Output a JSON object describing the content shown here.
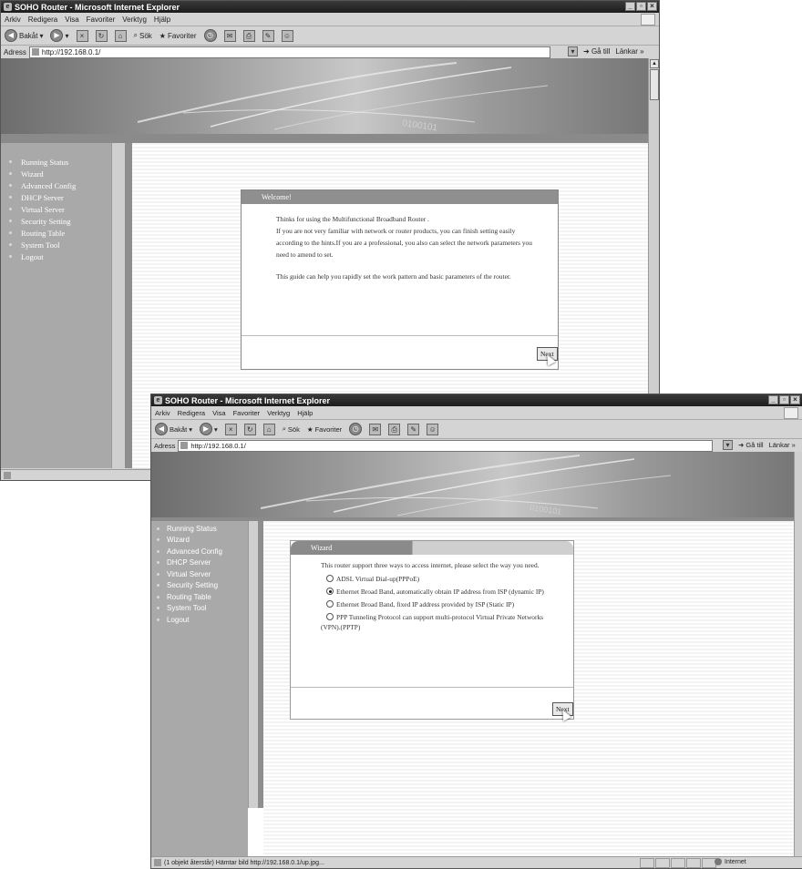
{
  "window1": {
    "title": "SOHO Router - Microsoft Internet Explorer",
    "menu": [
      "Arkiv",
      "Redigera",
      "Visa",
      "Favoriter",
      "Verktyg",
      "Hjälp"
    ],
    "toolbar": {
      "back": "Bakåt",
      "search": "Sök",
      "favorites": "Favoriter"
    },
    "address_label": "Adress",
    "url": "http://192.168.0.1/",
    "go_label": "Gå till",
    "links_label": "Länkar",
    "links_chevron": "»",
    "banner_text": "0100101",
    "sidebar": [
      "Running Status",
      "Wizard",
      "Advanced Config",
      "DHCP Server",
      "Virtual Server",
      "Security Setting",
      "Routing Table",
      "System Tool",
      "Logout"
    ],
    "panel_title": "Welcome!",
    "paragraphs": [
      "Thinks for using the Multifunctional Broadband Router .",
      "If you are not very familiar with network or router products, you can finish setting easily according to the hints.If you are a professional, you also can select the network parameters you need to amend to set.",
      "This guide can help you rapidly set the work pattern and basic parameters of the router."
    ],
    "next_label": "Next"
  },
  "window2": {
    "title": "SOHO Router - Microsoft Internet Explorer",
    "menu": [
      "Arkiv",
      "Redigera",
      "Visa",
      "Favoriter",
      "Verktyg",
      "Hjälp"
    ],
    "toolbar": {
      "back": "Bakåt",
      "search": "Sök",
      "favorites": "Favoriter"
    },
    "address_label": "Adress",
    "url": "http://192.168.0.1/",
    "go_label": "Gå till",
    "links_label": "Länkar",
    "links_chevron": "»",
    "banner_text": "0100101",
    "sidebar": [
      "Running Status",
      "Wizard",
      "Advanced Config",
      "DHCP Server",
      "Virtual Server",
      "Security Setting",
      "Routing Table",
      "System Tool",
      "Logout"
    ],
    "panel_title": "Wizard",
    "intro": "This router support three ways to access internet, please select the way you need.",
    "options": [
      {
        "label": "ADSL Virtual Dial-up(PPPoE)",
        "selected": false
      },
      {
        "label": "Ethernet Broad Band, automatically obtain IP address from ISP (dynamic IP)",
        "selected": true
      },
      {
        "label": "Ethernet Broad Band, fixed IP address provided by ISP (Static IP)",
        "selected": false
      },
      {
        "label": "PPP Tunneling Protocol can support multi-protocol Virtual Private Networks (VPN).(PPTP)",
        "selected": false
      }
    ],
    "next_label": "Next",
    "status_text": "(1 objekt återstår) Hämtar bild http://192.168.0.1/up.jpg...",
    "zone_label": "Internet"
  }
}
